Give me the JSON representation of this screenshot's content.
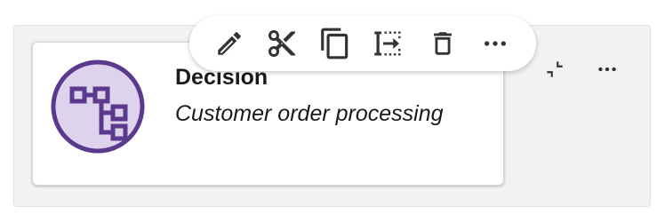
{
  "node": {
    "title": "Decision",
    "subtitle": "Customer order processing",
    "icon": "decision-flow-icon",
    "icon_color": "#5b3a8e",
    "icon_fill": "#ddd3ec"
  },
  "toolbar": {
    "actions": [
      {
        "icon": "pencil-edit-icon"
      },
      {
        "icon": "scissors-cut-icon"
      },
      {
        "icon": "copy-icon"
      },
      {
        "icon": "insert-after-icon"
      },
      {
        "icon": "trash-delete-icon"
      },
      {
        "icon": "more-horizontal-icon"
      }
    ]
  },
  "corner_controls": [
    {
      "icon": "collapse-icon"
    },
    {
      "icon": "more-horizontal-icon"
    }
  ],
  "colors": {
    "icon_dark": "#333333",
    "canvas_bg": "#f2f2f2"
  }
}
